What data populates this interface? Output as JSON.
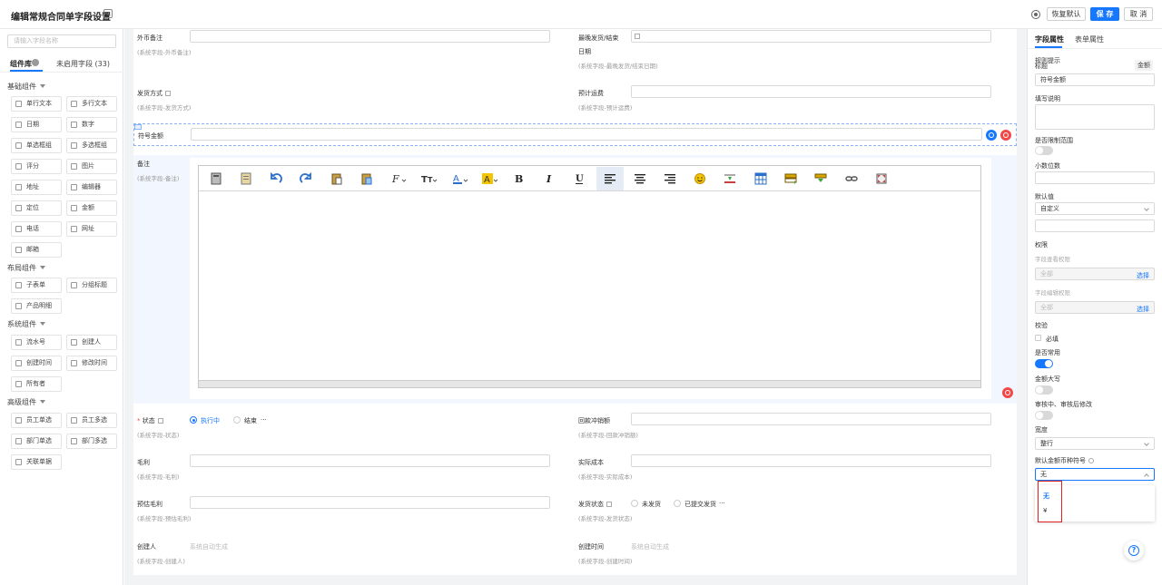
{
  "header": {
    "title": "编辑常规合同单字段设置",
    "restore_label": "恢复默认",
    "save_label": "保 存",
    "cancel_label": "取 消"
  },
  "left": {
    "search_placeholder": "请输入字段名称",
    "tab_library": "组件库",
    "tab_unused": "未启用字段 (33)",
    "groups": [
      {
        "title": "基础组件",
        "items": [
          "单行文本",
          "多行文本",
          "日期",
          "数字",
          "单选框组",
          "多选框组",
          "评分",
          "图片",
          "地址",
          "编辑器",
          "定位",
          "金额",
          "电话",
          "网址",
          "邮箱"
        ]
      },
      {
        "title": "布局组件",
        "items": [
          "子表单",
          "分组标题",
          "产品明细"
        ]
      },
      {
        "title": "系统组件",
        "items": [
          "流水号",
          "创建人",
          "创建时间",
          "修改时间",
          "所有者"
        ]
      },
      {
        "title": "高级组件",
        "items": [
          "员工单选",
          "员工多选",
          "部门单选",
          "部门多选",
          "关联单据"
        ]
      }
    ]
  },
  "canvas": {
    "foreign_remark": {
      "label": "外币备注",
      "sub": "(系统字段-外币备注)"
    },
    "latest_ship": {
      "label1": "最晚发货/结束",
      "label2": "日期",
      "sub": "(系统字段-最晚发货/结束日期)"
    },
    "ship_method": {
      "label": "发货方式",
      "sub": "(系统字段-发货方式)"
    },
    "est_freight": {
      "label": "预计运费",
      "sub": "(系统字段-预计运费)"
    },
    "symbol_amount": {
      "label": "符号金额"
    },
    "remark": {
      "label": "备注",
      "sub": "(系统字段-备注)"
    },
    "status": {
      "req": "* ",
      "label": "状态",
      "sub": "(系统字段-状态)",
      "opt1": "执行中",
      "opt2": "结束",
      "more": "···"
    },
    "refund_offset": {
      "label": "回款冲销额",
      "sub": "(系统字段-回款冲销额)"
    },
    "gross_profit": {
      "label": "毛利",
      "sub": "(系统字段-毛利)"
    },
    "actual_cost": {
      "label": "实际成本",
      "sub": "(系统字段-实际成本)"
    },
    "est_gross": {
      "label": "预估毛利",
      "sub": "(系统字段-预估毛利)"
    },
    "ship_status": {
      "label": "发货状态",
      "sub": "(系统字段-发货状态)",
      "opt1": "未发货",
      "opt2": "已提交发货",
      "more": "···"
    },
    "creator": {
      "label": "创建人",
      "hint": "系统自动生成",
      "sub": "(系统字段-创建人)"
    },
    "create_time": {
      "label": "创建时间",
      "hint": "系统自动生成",
      "sub": "(系统字段-创建时间)"
    }
  },
  "right": {
    "tab_field": "字段属性",
    "tab_form": "表单属性",
    "title_hint1": "规则提示",
    "title_hint2": "标题",
    "currency_btn": "金额",
    "title_value": "符号金额",
    "desc_label": "填写说明",
    "limit_label": "是否限制范围",
    "decimals_label": "小数位数",
    "default_label": "默认值",
    "default_value": "自定义",
    "perm_label": "权限",
    "view_perm": "字段查看权限",
    "view_value": "全部",
    "edit_perm": "字段编辑权限",
    "edit_value": "全部",
    "choose": "选择",
    "check_label": "校验",
    "required": "必填",
    "common_label": "是否常用",
    "uppercase_label": "金额大写",
    "audit_label": "审核中、审核后修改",
    "width_label": "宽度",
    "width_value": "整行",
    "currency_symbol_label": "默认金额币种符号",
    "currency_value": "无",
    "options": [
      "无",
      "¥"
    ]
  },
  "colors": {
    "primary": "#1677ff",
    "danger": "#f24848",
    "highlight": "#e02020"
  }
}
